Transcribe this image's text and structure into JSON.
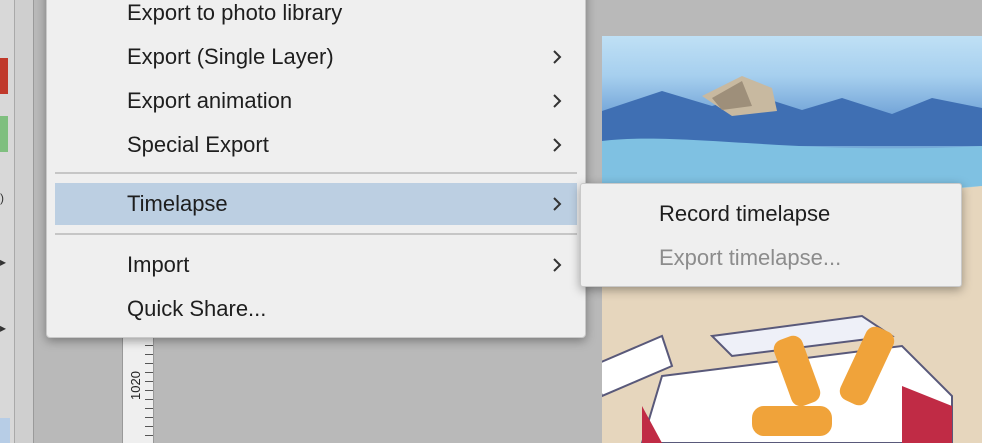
{
  "menu": {
    "items": [
      {
        "label": "Export to photo library",
        "submenu_icon": ""
      },
      {
        "label": "Export (Single Layer)",
        "submenu_icon": "chevron-right-icon"
      },
      {
        "label": "Export animation",
        "submenu_icon": "chevron-right-icon"
      },
      {
        "label": "Special Export",
        "submenu_icon": "chevron-right-icon"
      },
      {
        "label": "Timelapse",
        "submenu_icon": "chevron-right-icon"
      },
      {
        "label": "Import",
        "submenu_icon": "chevron-right-icon"
      },
      {
        "label": "Quick Share...",
        "submenu_icon": ""
      }
    ],
    "highlighted": "Timelapse"
  },
  "submenu": {
    "items": [
      {
        "label": "Record timelapse",
        "enabled": true
      },
      {
        "label": "Export timelapse...",
        "enabled": false
      }
    ]
  },
  "ruler": {
    "label": "1020"
  },
  "colors": {
    "menu_bg": "#efefef",
    "highlight": "#bccfe2",
    "text": "#1e1e1e",
    "disabled_text": "#8c8c8c"
  }
}
